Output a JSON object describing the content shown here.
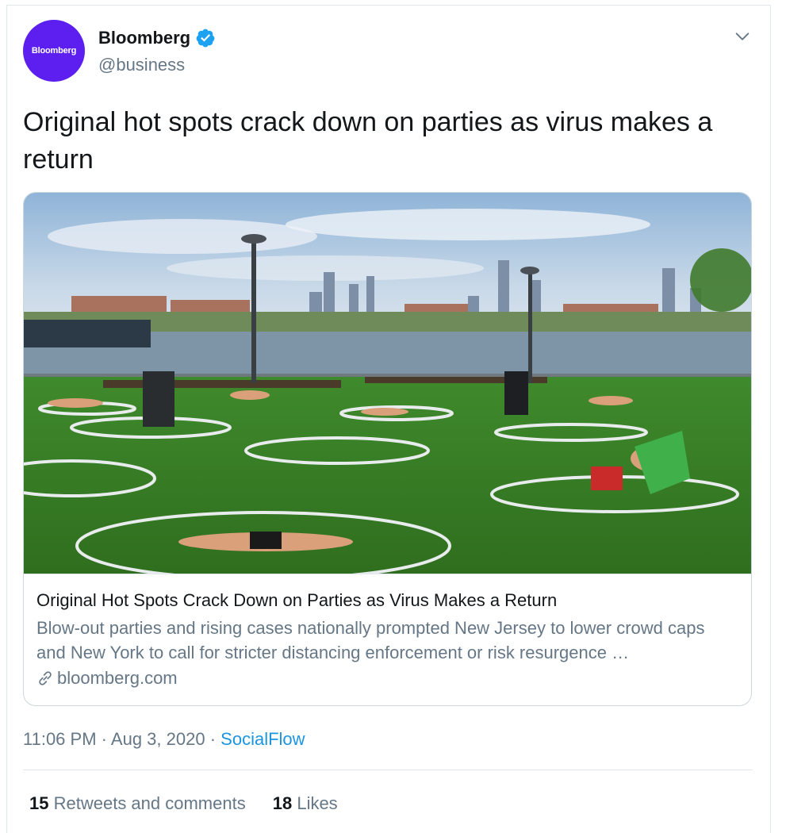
{
  "author": {
    "display_name": "Bloomberg",
    "handle": "@business",
    "avatar_text": "Bloomberg",
    "avatar_color": "#5d1ff0",
    "verified": true,
    "verified_color": "#1da1f2"
  },
  "tweet": {
    "text": "Original hot spots crack down on parties as virus makes a return"
  },
  "link_card": {
    "title": "Original Hot Spots Crack Down on Parties as Virus Makes a Return",
    "description": "Blow-out parties and rising cases nationally prompted New Jersey to lower crowd caps and New York to call for stricter distancing enforcement or risk resurgence …",
    "domain": "bloomberg.com",
    "image": "park-social-distancing-circles-photo"
  },
  "meta": {
    "time": "11:06 PM",
    "separator": "·",
    "date": "Aug 3, 2020",
    "source": "SocialFlow"
  },
  "stats": {
    "retweets_count": "15",
    "retweets_label": "Retweets and comments",
    "likes_count": "18",
    "likes_label": "Likes"
  },
  "colors": {
    "text_primary": "#14171a",
    "text_secondary": "#657786",
    "link_blue": "#1b95e0",
    "border": "#e1e8ed"
  },
  "icons": {
    "caret": "chevron-down-icon",
    "verified": "verified-badge-icon",
    "link": "link-icon"
  }
}
